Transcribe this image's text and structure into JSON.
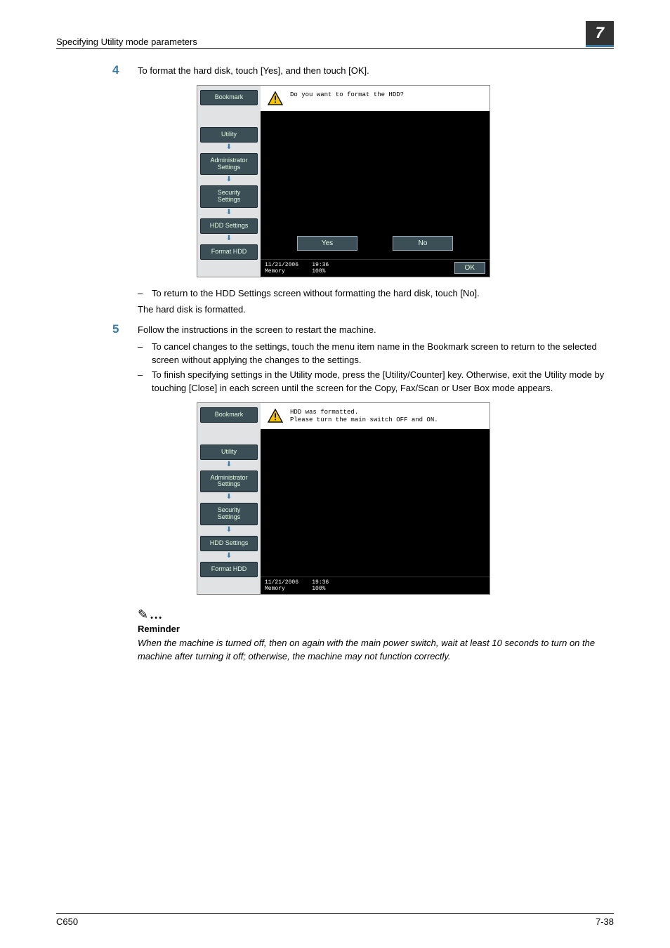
{
  "header": {
    "title": "Specifying Utility mode parameters",
    "chapter": "7"
  },
  "step4": {
    "num": "4",
    "text": "To format the hard disk, touch [Yes], and then touch [OK].",
    "after1": "To return to the HDD Settings screen without formatting the hard disk, touch [No].",
    "after2": "The hard disk is formatted."
  },
  "step5": {
    "num": "5",
    "text": "Follow the instructions in the screen to restart the machine.",
    "b1": "To cancel changes to the settings, touch the menu item name in the Bookmark screen to return to the selected screen without applying the changes to the settings.",
    "b2": "To finish specifying settings in the Utility mode, press the [Utility/Counter] key. Otherwise, exit the Utility mode by touching [Close] in each screen until the screen for the Copy, Fax/Scan or User Box mode appears."
  },
  "panel": {
    "sidebar": {
      "bookmark": "Bookmark",
      "utility": "Utility",
      "admin": "Administrator\nSettings",
      "security": "Security\nSettings",
      "hdd": "HDD Settings",
      "format": "Format HDD"
    },
    "msg1": "Do you want to format the HDD?",
    "msg2": "HDD was formatted.\nPlease turn the main switch OFF and ON.",
    "yes": "Yes",
    "no": "No",
    "ok": "OK",
    "status_date": "11/21/2006",
    "status_mem": "Memory",
    "status_time": "19:36",
    "status_pct": "100%"
  },
  "reminder": {
    "label": "Reminder",
    "text": "When the machine is turned off, then on again with the main power switch, wait at least 10 seconds to turn on the machine after turning it off; otherwise, the machine may not function correctly."
  },
  "footer": {
    "left": "C650",
    "right": "7-38"
  }
}
